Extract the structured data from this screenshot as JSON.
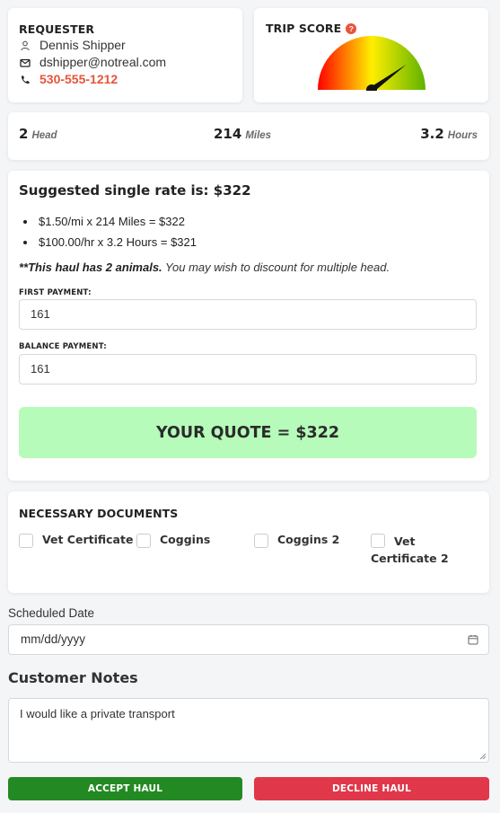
{
  "requester": {
    "heading": "REQUESTER",
    "name": "Dennis Shipper",
    "email": "dshipper@notreal.com",
    "phone": "530-555-1212",
    "icons": [
      "user-icon",
      "envelope-icon",
      "phone-icon"
    ]
  },
  "trip_score": {
    "heading": "TRIP SCORE",
    "help_icon": "question-circle-icon",
    "gauge_level": 0.8,
    "colors": {
      "low": "#ff0000",
      "mid": "#ffee00",
      "high": "#5fb300",
      "help": "#e8543b"
    }
  },
  "stats": [
    {
      "value": "2",
      "unit": "Head"
    },
    {
      "value": "214",
      "unit": "Miles"
    },
    {
      "value": "3.2",
      "unit": "Hours"
    }
  ],
  "rate": {
    "title": "Suggested single rate is: $322",
    "bullets": [
      "$1.50/mi x 214 Miles = $322",
      "$100.00/hr x 3.2 Hours = $321"
    ],
    "note_bold": "**This haul has 2 animals.",
    "note_rest": " You may wish to discount for multiple head.",
    "first_payment_label": "FIRST PAYMENT:",
    "first_payment_value": "161",
    "balance_payment_label": "BALANCE PAYMENT:",
    "balance_payment_value": "161",
    "quote": "YOUR QUOTE = $322",
    "quote_bg": "#b6fbb9"
  },
  "documents": {
    "heading": "NECESSARY DOCUMENTS",
    "items": [
      "Vet Certificate",
      "Coggins",
      "Coggins 2",
      "Vet Certificate 2"
    ]
  },
  "schedule": {
    "label": "Scheduled Date",
    "placeholder": "mm/dd/yyyy",
    "icon": "calendar-icon"
  },
  "notes": {
    "title": "Customer Notes",
    "value": "I would like a private transport"
  },
  "actions": {
    "accept_label": "ACCEPT HAUL",
    "decline_label": "DECLINE HAUL",
    "accept_color": "#238a23",
    "decline_color": "#e0384a"
  }
}
